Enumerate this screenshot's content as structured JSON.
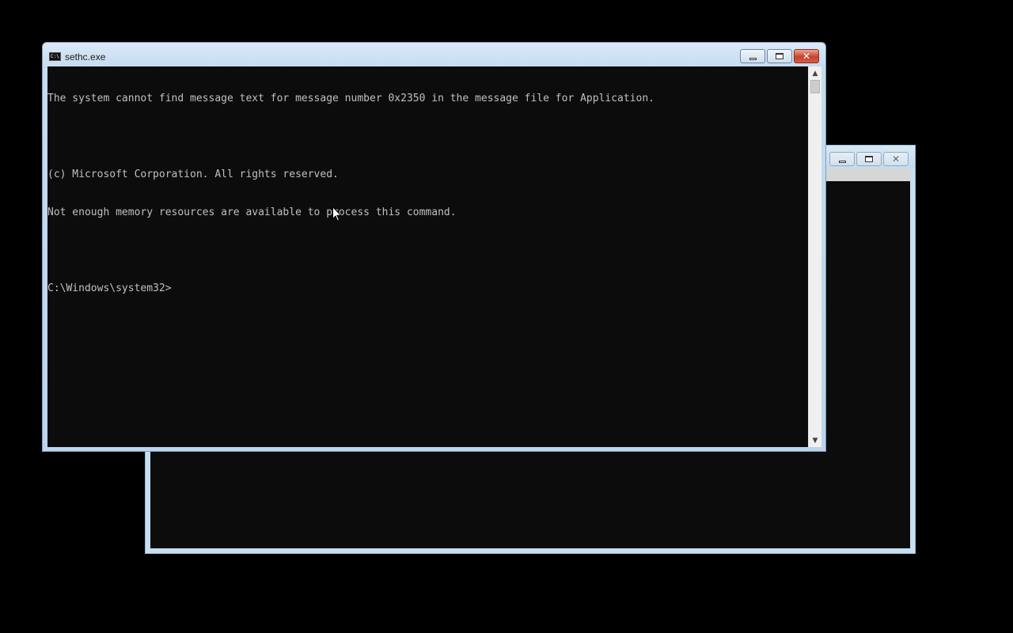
{
  "background_window": {
    "controls": {
      "minimize_icon": "minimize-icon",
      "maximize_icon": "maximize-icon",
      "close_icon": "close-icon"
    }
  },
  "window": {
    "title": "sethc.exe",
    "app_icon": "console-icon",
    "app_icon_glyph": "C:\\",
    "controls": {
      "minimize_icon": "minimize-icon",
      "maximize_icon": "maximize-icon",
      "close_icon": "close-icon",
      "close_glyph": "✕"
    },
    "console": {
      "lines": [
        "The system cannot find message text for message number 0x2350 in the message file for Application.",
        "",
        "(c) Microsoft Corporation. All rights reserved.",
        "Not enough memory resources are available to process this command.",
        "",
        "C:\\Windows\\system32>"
      ],
      "text_color": "#c0c0c0",
      "background_color": "#0c0c0c"
    },
    "scrollbar": {
      "up_arrow": "▲",
      "down_arrow": "▼"
    }
  },
  "colors": {
    "desktop": "#000000",
    "frame_active": "#c5dcf0",
    "close_button": "#c8432d"
  }
}
